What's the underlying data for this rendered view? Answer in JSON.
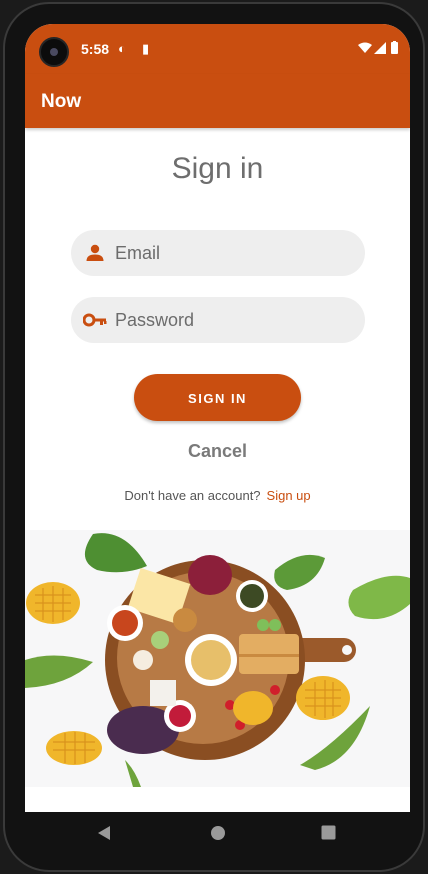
{
  "status_bar": {
    "time": "5:58"
  },
  "app_bar": {
    "title": "Now"
  },
  "form": {
    "title": "Sign in",
    "email_placeholder": "Email",
    "password_placeholder": "Password",
    "sign_in_label": "SIGN IN",
    "cancel_label": "Cancel",
    "no_account_text": "Don't have an account?",
    "sign_up_label": "Sign up"
  },
  "icons": [
    "person-icon",
    "key-icon",
    "back-icon",
    "home-icon",
    "recents-icon",
    "wifi-icon",
    "signal-icon",
    "battery-icon"
  ],
  "colors": {
    "accent": "#c94e10",
    "field_bg": "#eeeeee",
    "title_text": "#6e6e6e"
  }
}
